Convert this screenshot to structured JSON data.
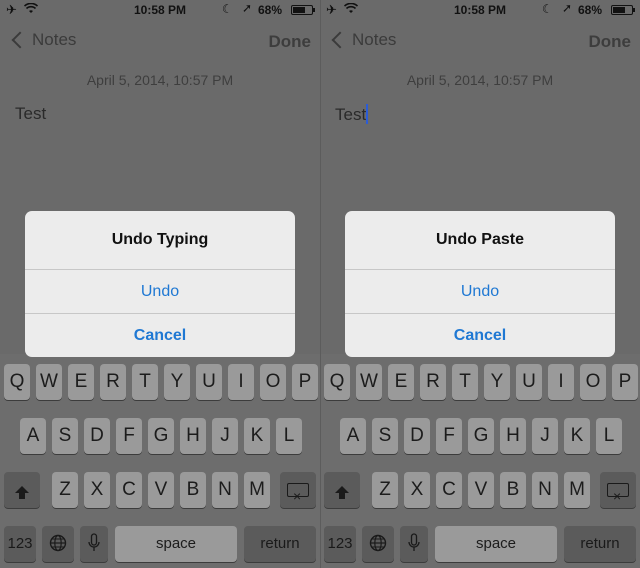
{
  "status": {
    "time": "10:58 PM",
    "battery": "68%"
  },
  "nav": {
    "back_label": "Notes",
    "done_label": "Done"
  },
  "note": {
    "date": "April 5, 2014, 10:57 PM",
    "text": "Test"
  },
  "alerts": {
    "left": {
      "title": "Undo Typing",
      "undo_label": "Undo",
      "cancel_label": "Cancel"
    },
    "right": {
      "title": "Undo Paste",
      "undo_label": "Undo",
      "cancel_label": "Cancel"
    }
  },
  "keyboard": {
    "row1": [
      "Q",
      "W",
      "E",
      "R",
      "T",
      "Y",
      "U",
      "I",
      "O",
      "P"
    ],
    "row2": [
      "A",
      "S",
      "D",
      "F",
      "G",
      "H",
      "J",
      "K",
      "L"
    ],
    "row3": [
      "Z",
      "X",
      "C",
      "V",
      "B",
      "N",
      "M"
    ],
    "numbers_label": "123",
    "space_label": "space",
    "return_label": "return",
    "icons": {
      "shift": "shift-icon",
      "delete": "delete-icon",
      "globe": "globe-icon",
      "mic": "microphone-icon"
    }
  },
  "colors": {
    "alert_button": "#1f78d3",
    "dim_background": "#6a6a6a",
    "cursor": "#2b5cd6"
  }
}
